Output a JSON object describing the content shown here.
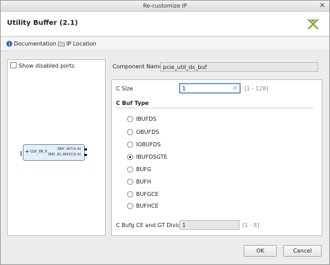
{
  "window": {
    "title": "Re-customize IP",
    "close_glyph": "✕"
  },
  "header": {
    "ip_title": "Utility Buffer (2.1)",
    "logo_icon": "xilinx-logo-icon"
  },
  "links": {
    "documentation": "Documentation",
    "ip_location": "IP Location"
  },
  "left_panel": {
    "show_disabled_ports": "Show disabled ports",
    "show_disabled_ports_checked": false,
    "block": {
      "expand": "+",
      "input_port": "CLK_IN_D",
      "output_ports": [
        "IBUF_OUT[0:0]",
        "IBUF_DS_ODIV2[0:0]"
      ]
    }
  },
  "component": {
    "label": "Component Name",
    "value": "pcie_util_ds_buf"
  },
  "params": {
    "c_size": {
      "label": "C Size",
      "value": "1",
      "range": "[1 - 128]"
    },
    "c_buf_type": {
      "title": "C Buf Type",
      "options": [
        "IBUFDS",
        "OBUFDS",
        "IOBUFDS",
        "IBUFDSGTE",
        "BUFG",
        "BUFH",
        "BUFGCE",
        "BUFHCE"
      ],
      "selected": "IBUFDSGTE"
    },
    "c_bufg_ce_gt_divide": {
      "label": "C Bufg CE and GT Divide",
      "value": "1",
      "range": "[1 - 8]"
    }
  },
  "buttons": {
    "ok": "OK",
    "cancel": "Cancel"
  },
  "colors": {
    "accent": "#3c7fd6",
    "logo": "#7aa323"
  }
}
